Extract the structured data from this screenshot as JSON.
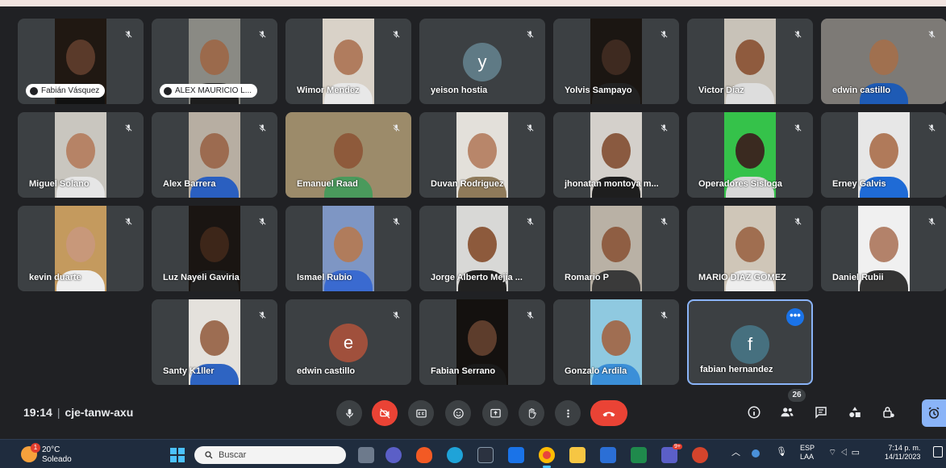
{
  "meeting": {
    "time": "19:14",
    "code": "cje-tanw-axu",
    "participant_count": "26"
  },
  "participants": [
    {
      "name": "Fabián Vásquez",
      "pill": true,
      "video": "#201812",
      "skin": "#5a3a2a",
      "shirt": "#111"
    },
    {
      "name": "ALEX MAURICIO L...",
      "pill": true,
      "video": "#8a8a84",
      "skin": "#9b6a4c",
      "shirt": "#1d1d1d"
    },
    {
      "name": "Wimor Mendez",
      "pill": false,
      "video": "#d9d2c8",
      "skin": "#b07c5e",
      "shirt": "#e8e8e8"
    },
    {
      "name": "yeison hostia",
      "pill": false,
      "avatar": "y",
      "avatar_color": "#5f7a85"
    },
    {
      "name": "Yolvis Sampayo",
      "pill": false,
      "video": "#1b1612",
      "skin": "#3e2a20",
      "shirt": "#222"
    },
    {
      "name": "Victor Diaz",
      "pill": false,
      "video": "#c8c2b8",
      "skin": "#8f5b3e",
      "shirt": "#ddd"
    },
    {
      "name": "edwin castillo",
      "pill": false,
      "video": "#7d7a76",
      "skin": "#a0704f",
      "shirt": "#1e5bb5",
      "wide": true
    },
    {
      "name": "Miguel Solano",
      "pill": false,
      "video": "#c9c6bf",
      "skin": "#b68366",
      "shirt": "#e6e6e6"
    },
    {
      "name": "Alex Barrera",
      "pill": false,
      "video": "#b7aea2",
      "skin": "#9c6b50",
      "shirt": "#2a5fc0"
    },
    {
      "name": "Emanuel Raad",
      "pill": false,
      "video": "#9c8b6a",
      "skin": "#8e5a3b",
      "shirt": "#4a9a5c",
      "wide": true
    },
    {
      "name": "Duvan Rodriguez",
      "pill": false,
      "video": "#e3e0da",
      "skin": "#b8866a",
      "shirt": "#8f7a5a"
    },
    {
      "name": "jhonatan montoya m...",
      "pill": false,
      "video": "#d4d0cb",
      "skin": "#8a5a40",
      "shirt": "#1e1e1e"
    },
    {
      "name": "Operadores Sisloga",
      "pill": false,
      "video": "#35c24a",
      "skin": "#3a2a20",
      "shirt": "#d8d8d8"
    },
    {
      "name": "Erney Galvis",
      "pill": false,
      "video": "#e7e7e7",
      "skin": "#b07a5a",
      "shirt": "#1f6bd6"
    },
    {
      "name": "kevin duarte",
      "pill": false,
      "video": "#c49a5e",
      "skin": "#c8987a",
      "shirt": "#eee"
    },
    {
      "name": "Luz Nayeli Gaviria",
      "pill": false,
      "video": "#1a1512",
      "skin": "#3d2619",
      "shirt": "#222"
    },
    {
      "name": "Ismael Rubio",
      "pill": false,
      "video": "#7e96c4",
      "skin": "#b07c5c",
      "shirt": "#3a6ad0"
    },
    {
      "name": "Jorge Alberto Mejia ...",
      "pill": false,
      "video": "#d8d8d6",
      "skin": "#8d5a3c",
      "shirt": "#222"
    },
    {
      "name": "Romario P",
      "pill": false,
      "video": "#b9b1a5",
      "skin": "#8f5e43",
      "shirt": "#3a3a3a"
    },
    {
      "name": "MARIO DIAZ GOMEZ",
      "pill": false,
      "video": "#cfc6b8",
      "skin": "#a06e50",
      "shirt": "#eee"
    },
    {
      "name": "Daniel Rubii",
      "pill": false,
      "video": "#f0f0f0",
      "skin": "#b3826a",
      "shirt": "#333"
    },
    {
      "name": "Santy K1ller",
      "pill": false,
      "video": "#e4e1dc",
      "skin": "#9d6d52",
      "shirt": "#2e64c2"
    },
    {
      "name": "edwin castillo",
      "pill": false,
      "avatar": "e",
      "avatar_color": "#a0503c"
    },
    {
      "name": "Fabian Serrano",
      "pill": false,
      "video": "#14110f",
      "skin": "#5d3d2c",
      "shirt": "#1a1a1a"
    },
    {
      "name": "Gonzalo Ardila",
      "pill": false,
      "video": "#8fc9e0",
      "skin": "#a06e52",
      "shirt": "#3b8fd8"
    },
    {
      "name": "fabian hernandez",
      "pill": false,
      "avatar": "f",
      "avatar_color": "#46707f",
      "active": true
    }
  ],
  "controls": [
    {
      "name": "mic-toggle-button",
      "icon": "mic-icon"
    },
    {
      "name": "camera-toggle-button",
      "icon": "camera-off-icon",
      "red": true
    },
    {
      "name": "captions-button",
      "icon": "captions-icon"
    },
    {
      "name": "reactions-button",
      "icon": "emoji-icon"
    },
    {
      "name": "present-button",
      "icon": "present-icon"
    },
    {
      "name": "raise-hand-button",
      "icon": "hand-icon"
    },
    {
      "name": "more-options-button",
      "icon": "more-vert-icon"
    }
  ],
  "taskbar": {
    "temperature": "20°C",
    "weather": "Soleado",
    "search_placeholder": "Buscar",
    "notification_count": "1",
    "lang": "ESP",
    "layout": "LAA",
    "time": "7:14 p. m.",
    "date": "14/11/2023",
    "teams_badge": "9+"
  },
  "colors": {
    "background": "#202124",
    "tile": "#3c4043",
    "red": "#ea4335",
    "accent": "#8ab4f8"
  }
}
